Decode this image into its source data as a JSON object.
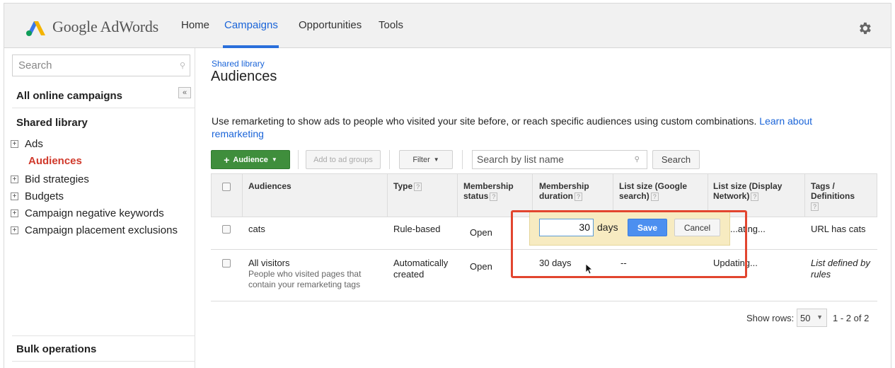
{
  "app": {
    "logo_text": "Google AdWords"
  },
  "nav": {
    "items": [
      "Home",
      "Campaigns",
      "Opportunities",
      "Tools"
    ],
    "active": "Campaigns"
  },
  "sidebar": {
    "search_placeholder": "Search",
    "all_campaigns": "All online campaigns",
    "collapse_label": "«",
    "shared_library": "Shared library",
    "items": [
      {
        "label": "Ads",
        "expandable": true
      },
      {
        "label": "Audiences",
        "expandable": false,
        "active": true
      },
      {
        "label": "Bid strategies",
        "expandable": true
      },
      {
        "label": "Budgets",
        "expandable": true
      },
      {
        "label": "Campaign negative keywords",
        "expandable": true
      },
      {
        "label": "Campaign placement exclusions",
        "expandable": true
      }
    ],
    "bulk_operations": "Bulk operations"
  },
  "main": {
    "breadcrumb": "Shared library",
    "title": "Audiences",
    "description": "Use remarketing to show ads to people who visited your site before, or reach specific audiences using custom combinations. ",
    "description_link_a": "Learn about",
    "description_link_b": "remarketing"
  },
  "toolbar": {
    "audience_button": "Audience",
    "add_to_ad_groups": "Add to ad groups",
    "filter": "Filter",
    "search_placeholder": "Search by list name",
    "search_button": "Search"
  },
  "table": {
    "headers": {
      "audiences": "Audiences",
      "type": "Type",
      "membership_status_1": "Membership",
      "membership_status_2": "status",
      "membership_duration_1": "Membership",
      "membership_duration_2": "duration",
      "list_size_search_1": "List size (Google",
      "list_size_search_2": "search)",
      "list_size_display_1": "List size (Display",
      "list_size_display_2": "Network)",
      "tags_1": "Tags /",
      "tags_2": "Definitions"
    },
    "rows": [
      {
        "name": "cats",
        "type": "Rule-based",
        "status": "Open",
        "display_size": "...ating...",
        "tags": "URL has cats"
      },
      {
        "name": "All visitors",
        "desc_1": "People who visited pages that",
        "desc_2": "contain your remarketing tags",
        "type_1": "Automatically",
        "type_2": "created",
        "status": "Open",
        "duration": "30 days",
        "search_size": "--",
        "display_size": "Updating...",
        "tags_1": "List defined by",
        "tags_2": "rules"
      }
    ]
  },
  "inline_edit": {
    "value": "30",
    "unit": "days",
    "save": "Save",
    "cancel": "Cancel"
  },
  "pagination": {
    "show_rows_label": "Show rows:",
    "rows_per_page": "50",
    "range": "1 - 2 of 2"
  },
  "colors": {
    "accent_blue": "#1a64d8",
    "audience_green": "#3f8e3c",
    "active_red": "#d0392b",
    "highlight_red": "#e2452f",
    "edit_bg": "#f7ebc1"
  }
}
